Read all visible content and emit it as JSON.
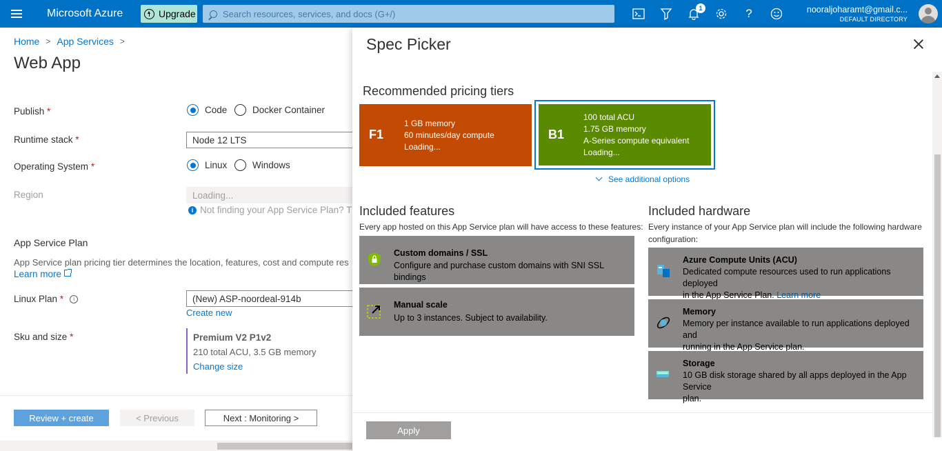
{
  "topbar": {
    "brand": "Microsoft Azure",
    "upgrade_label": "Upgrade",
    "search_placeholder": "Search resources, services, and docs (G+/)",
    "notification_count": "1",
    "account_email": "nooraljoharamt@gmail.c...",
    "account_directory": "DEFAULT DIRECTORY",
    "icons": [
      "cloud-shell-icon",
      "directory-filter-icon",
      "bell-icon",
      "gear-icon",
      "help-icon",
      "feedback-smiley-icon"
    ],
    "icon_glyphs": {
      "cloud_shell": ">_",
      "help": "?",
      "gear": "⚙",
      "smiley": "☺"
    }
  },
  "left": {
    "breadcrumb": [
      "Home",
      "App Services"
    ],
    "title": "Web App",
    "publish_label": "Publish",
    "publish_options": [
      "Code",
      "Docker Container"
    ],
    "runtime_label": "Runtime stack",
    "runtime_value": "Node 12 LTS",
    "os_label": "Operating System",
    "os_options": [
      "Linux",
      "Windows"
    ],
    "region_label": "Region",
    "region_value": "Loading...",
    "region_hint": "Not finding your App Service Plan? T",
    "plan_heading": "App Service Plan",
    "plan_desc": "App Service plan pricing tier determines the location, features, cost and compute res",
    "learn_more": "Learn more",
    "linux_plan_label": "Linux Plan",
    "linux_plan_value": "(New) ASP-noordeal-914b",
    "create_new": "Create new",
    "sku_label": "Sku and size",
    "sku_title": "Premium V2 P1v2",
    "sku_desc": "210 total ACU, 3.5 GB memory",
    "sku_change": "Change size",
    "btn_review": "Review + create",
    "btn_previous": "< Previous",
    "btn_next": "Next : Monitoring >",
    "required_mark": "*"
  },
  "panel": {
    "title": "Spec Picker",
    "recommended_heading": "Recommended pricing tiers",
    "tiers": [
      {
        "code": "F1",
        "lines": [
          "1 GB memory",
          "60 minutes/day compute",
          "Loading..."
        ],
        "color": "#c34a02"
      },
      {
        "code": "B1",
        "lines": [
          "100 total ACU",
          "1.75 GB memory",
          "A-Series compute equivalent",
          "Loading..."
        ],
        "color": "#5a8a00",
        "selected": true
      }
    ],
    "see_additional": "See additional options",
    "features_heading": "Included features",
    "features_sub": "Every app hosted on this App Service plan will have access to these features:",
    "features": [
      {
        "title": "Custom domains / SSL",
        "desc": "Configure and purchase custom domains with SNI SSL bindings",
        "icon": "shield-lock-icon"
      },
      {
        "title": "Manual scale",
        "desc": "Up to 3 instances. Subject to availability.",
        "icon": "scale-arrow-icon"
      }
    ],
    "hardware_heading": "Included hardware",
    "hardware_sub": [
      "Every instance of your App Service plan will include the following hardware",
      "configuration:"
    ],
    "hardware": [
      {
        "title": "Azure Compute Units (ACU)",
        "desc": [
          "Dedicated compute resources used to run applications deployed",
          "in the App Service Plan."
        ],
        "link": "Learn more",
        "icon": "compute-icon"
      },
      {
        "title": "Memory",
        "desc": [
          "Memory per instance available to run applications deployed and",
          "running in the App Service plan."
        ],
        "icon": "memory-icon"
      },
      {
        "title": "Storage",
        "desc": [
          "10 GB disk storage shared by all apps deployed in the App Service",
          "plan."
        ],
        "icon": "storage-icon"
      }
    ],
    "apply_label": "Apply"
  },
  "colors": {
    "azure_blue": "#0072c6",
    "link": "#0078d4",
    "f1_tier": "#c34a02",
    "b1_tier": "#5a8a00",
    "card_gray": "#8a8886"
  }
}
